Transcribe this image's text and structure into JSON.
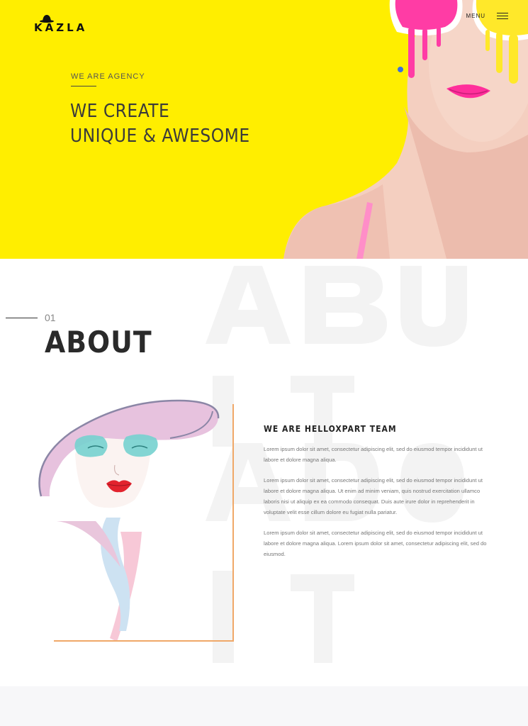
{
  "header": {
    "logo_text": "KAZLA",
    "menu_label": "MENU"
  },
  "hero": {
    "tag": "WE ARE AGENCY",
    "title_line1": "WE CREATE",
    "title_line2": "UNIQUE & AWESOME"
  },
  "about": {
    "number": "01",
    "title": "ABOUT",
    "heading": "WE ARE HELLOXPART TEAM",
    "paragraphs": [
      "Lorem ipsum dolor sit amet, consectetur adipiscing elit, sed do eiusmod tempor incididunt ut labore et dolore magna aliqua.",
      "Lorem ipsum dolor sit amet, consectetur adipiscing elit, sed do eiusmod tempor incididunt ut labore et dolore magna aliqua. Ut enim ad minim veniam, quis nostrud exercitation ullamco laboris nisi ut aliquip ex ea commodo consequat. Duis aute irure dolor in reprehenderit in voluptate velit esse cillum dolore eu fugiat nulla pariatur.",
      "Lorem ipsum dolor sit amet, consectetur adipiscing elit, sed do eiusmod tempor incididunt ut labore et dolore magna aliqua. Lorem ipsum dolor sit amet, consectetur adipiscing elit, sed do eiusmod."
    ]
  },
  "colors": {
    "hero_bg": "#ffee00",
    "frame_accent": "#f0a868"
  },
  "icons": {
    "logo": "hat-icon",
    "menu": "hamburger-icon"
  }
}
